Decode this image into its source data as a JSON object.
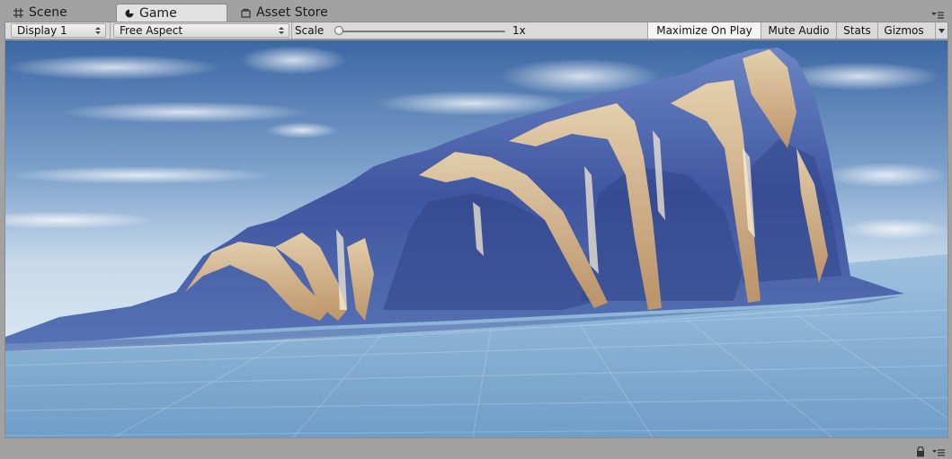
{
  "tabs": [
    {
      "label": "Scene",
      "icon": "grid-icon"
    },
    {
      "label": "Game",
      "icon": "game-icon"
    },
    {
      "label": "Asset Store",
      "icon": "store-icon"
    }
  ],
  "toolbar": {
    "display": "Display 1",
    "aspect": "Free Aspect",
    "scale_label": "Scale",
    "scale_value": "1x",
    "maximize_label": "Maximize On Play",
    "mute_label": "Mute Audio",
    "stats_label": "Stats",
    "gizmos_label": "Gizmos"
  },
  "colors": {
    "chrome": "#a2a2a2",
    "toolbar": "#dadada",
    "sky_top": "#3f6ba6",
    "sky_horizon": "#c9dbea",
    "water": "#7aa8cf",
    "wave_blue": "#4a63a8",
    "foam": "#e8c48e"
  }
}
